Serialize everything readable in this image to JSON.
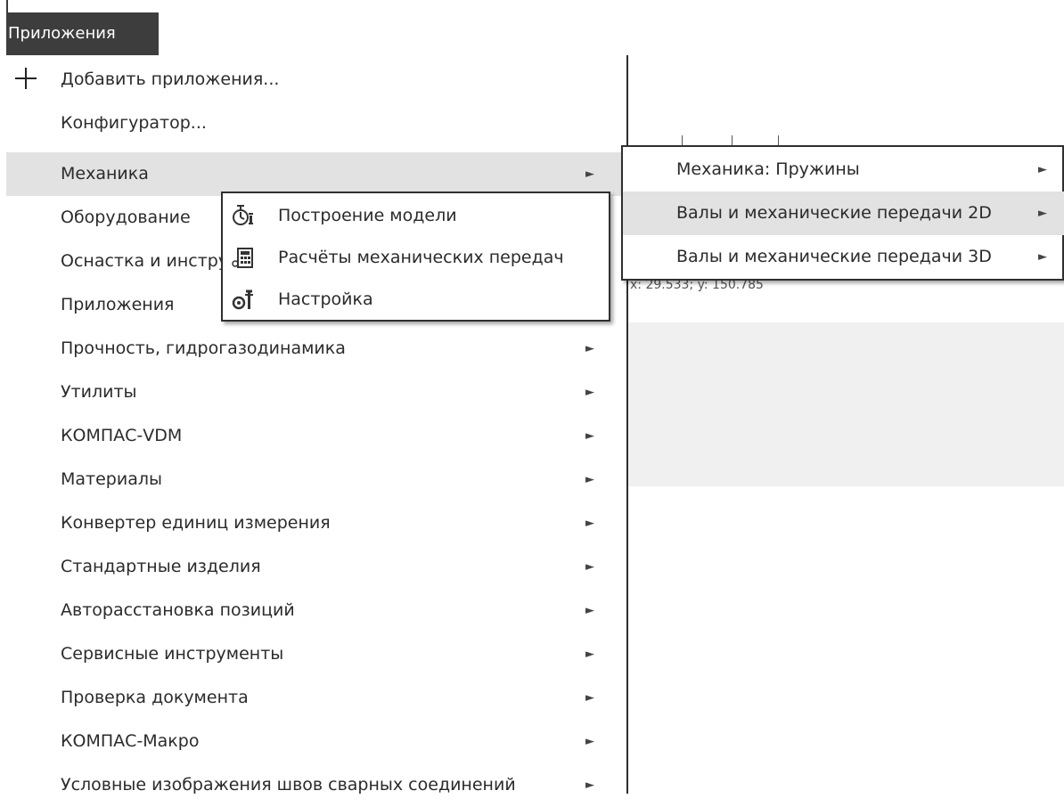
{
  "menu_tab": "Приложения",
  "top_items": [
    {
      "label": "Добавить приложения...",
      "icon": "plus-icon"
    },
    {
      "label": "Конфигуратор..."
    }
  ],
  "apps": [
    {
      "label": "Механика",
      "arrow": "►"
    },
    {
      "label": "Оборудование",
      "arrow": "►"
    },
    {
      "label": "Оснастка и инструмент",
      "arrow": "►"
    },
    {
      "label": "Приложения",
      "arrow": "►"
    },
    {
      "label": "Прочность, гидрогазодинамика",
      "arrow": "►"
    },
    {
      "label": "Утилиты",
      "arrow": "►"
    },
    {
      "label": "КОМПАС-VDM",
      "arrow": "►"
    },
    {
      "label": "Материалы",
      "arrow": "►"
    },
    {
      "label": "Конвертер единиц измерения",
      "arrow": "►"
    },
    {
      "label": "Стандартные изделия",
      "arrow": "►"
    },
    {
      "label": "Авторасстановка позиций",
      "arrow": "►"
    },
    {
      "label": "Сервисные инструменты",
      "arrow": "►"
    },
    {
      "label": "Проверка документа",
      "arrow": "►"
    },
    {
      "label": "КОМПАС-Макро",
      "arrow": "►"
    },
    {
      "label": "Условные изображения швов сварных соединений",
      "arrow": "►"
    }
  ],
  "mechanics_submenu": [
    {
      "label": "Механика: Пружины",
      "arrow": "►"
    },
    {
      "label": "Валы и механические передачи 2D",
      "arrow": "►"
    },
    {
      "label": "Валы и механические передачи 3D",
      "arrow": "►"
    }
  ],
  "shafts_submenu": [
    {
      "label": "Построение модели",
      "icon": "model-build-icon"
    },
    {
      "label": "Расчёты механических передач",
      "icon": "calculator-icon"
    },
    {
      "label": "Настройка",
      "icon": "settings-tools-icon"
    }
  ],
  "background": {
    "coords": "x: 29.533; y: 150.785"
  }
}
